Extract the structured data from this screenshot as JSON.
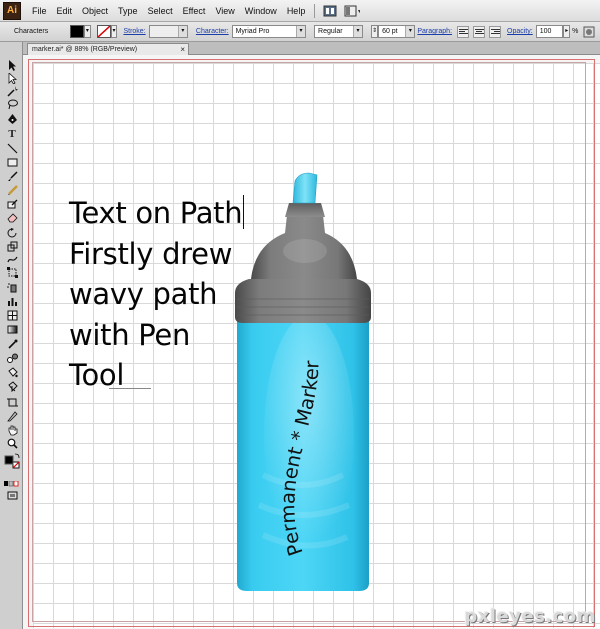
{
  "menubar": {
    "logo": "Ai",
    "items": [
      "File",
      "Edit",
      "Object",
      "Type",
      "Select",
      "Effect",
      "View",
      "Window",
      "Help"
    ]
  },
  "controlbar": {
    "panel_label": "Characters",
    "stroke_label": "Stroke:",
    "character_label": "Character:",
    "font_family": "Myriad Pro",
    "font_style": "Regular",
    "font_size": "60 pt",
    "paragraph_label": "Paragraph:",
    "opacity_label": "Opacity:",
    "opacity_value": "100",
    "percent": "%",
    "fill_color": "#000000"
  },
  "document": {
    "tab_title": "marker.ai* @ 88% (RGB/Preview)",
    "close_glyph": "×"
  },
  "artwork": {
    "text_lines": [
      "Text on Path",
      "Firstly drew",
      "wavy path",
      "with Pen",
      "Tool"
    ],
    "path_text": "Permanent * Marker",
    "marker_body_color": "#2cc6ec",
    "marker_cap_color": "#6e6e6e",
    "marker_tip_color": "#4fd0f0"
  },
  "watermark": "pxleyes.com"
}
